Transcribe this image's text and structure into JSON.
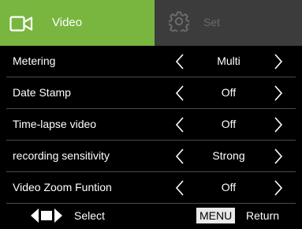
{
  "tabs": {
    "video": {
      "label": "Video",
      "icon": "video-camera-icon",
      "active": true,
      "color": "#79b640"
    },
    "set": {
      "label": "Set",
      "icon": "gear-icon",
      "active": false,
      "color": "#3c3c3c"
    }
  },
  "menu": {
    "items": [
      {
        "name": "Metering",
        "value": "Multi"
      },
      {
        "name": "Date Stamp",
        "value": "Off"
      },
      {
        "name": "Time-lapse video",
        "value": "Off"
      },
      {
        "name": "recording sensitivity",
        "value": "Strong"
      },
      {
        "name": "Video Zoom Funtion",
        "value": "Off"
      }
    ]
  },
  "footer": {
    "select_icon": "left-right-arrows-icon",
    "select_label": "Select",
    "menu_key": "MENU",
    "return_label": "Return"
  }
}
